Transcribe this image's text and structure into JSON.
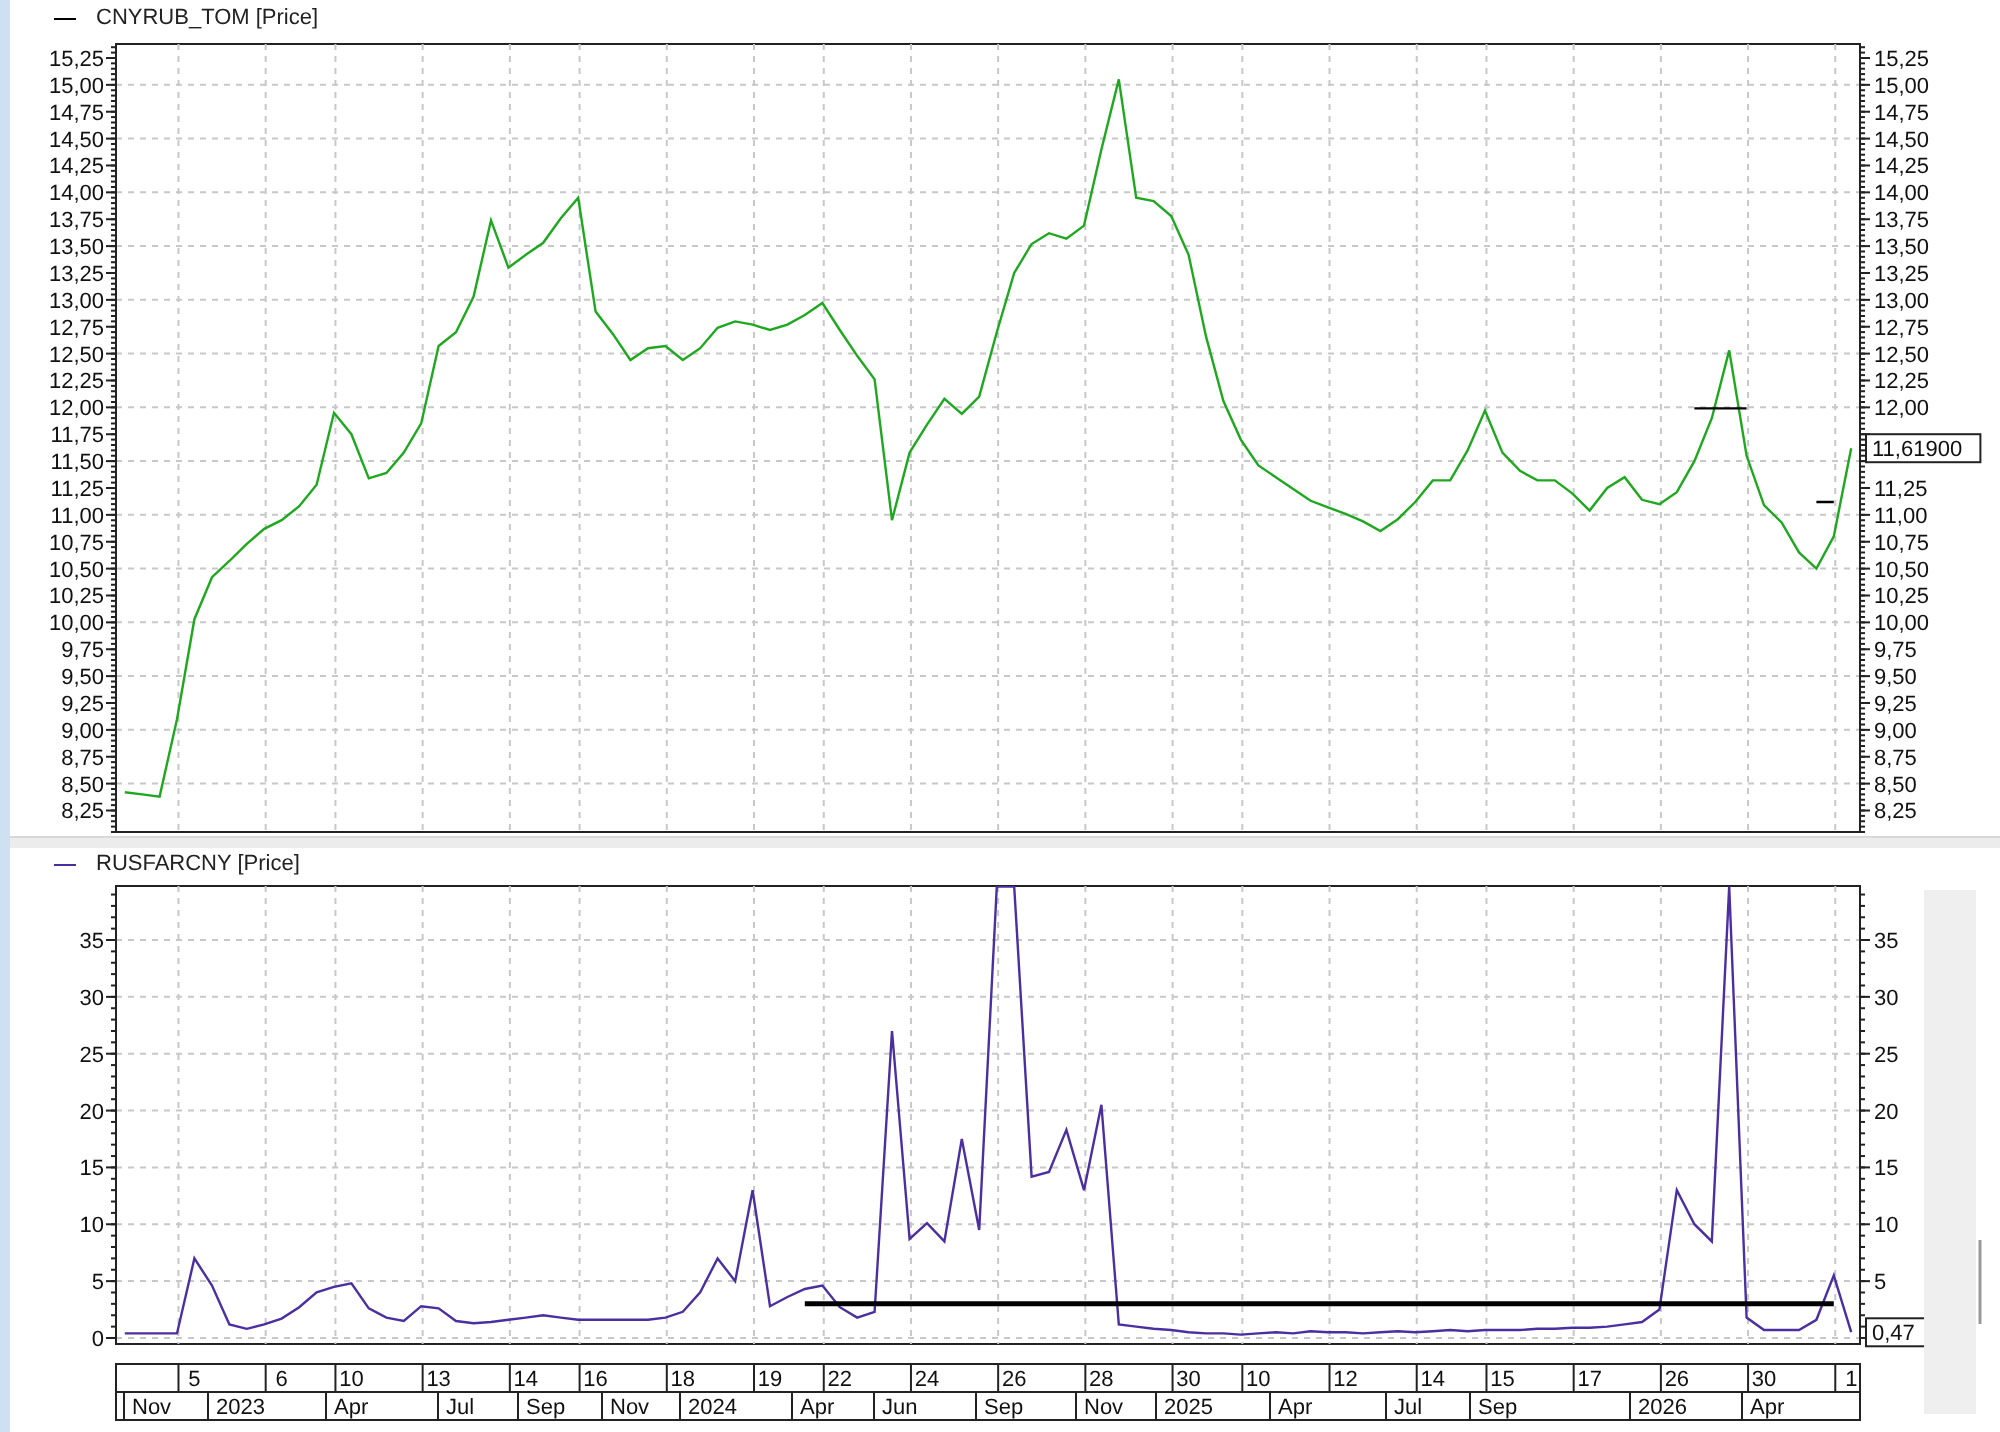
{
  "top_panel": {
    "chart_data": {
      "type": "line",
      "ylim": [
        8.05,
        15.38
      ],
      "categories": [
        null,
        null,
        null,
        null,
        null,
        null,
        null,
        null,
        null,
        null,
        null,
        null,
        null,
        null,
        null,
        null,
        null,
        null,
        null,
        null,
        null,
        null,
        null,
        null,
        null,
        null,
        null,
        null,
        null,
        null,
        null,
        null,
        null,
        null,
        null,
        null,
        null,
        null,
        null,
        null,
        null,
        null,
        null,
        null,
        null,
        null,
        null,
        null,
        null,
        null,
        null,
        null,
        null,
        null,
        null,
        null,
        null,
        null,
        null,
        null,
        null,
        null,
        null,
        null,
        null,
        null,
        null,
        null,
        null,
        null,
        null,
        null,
        null,
        null,
        null,
        null,
        null,
        null,
        null,
        null,
        null,
        null,
        null,
        null,
        null,
        null,
        null,
        null,
        null,
        null,
        null,
        null,
        null,
        null,
        null,
        null,
        null,
        null,
        null,
        null
      ],
      "yticks": [
        {
          "value": 15.25,
          "label": "15,25"
        },
        {
          "value": 15,
          "label": "15,00"
        },
        {
          "value": 14.75,
          "label": "14,75"
        },
        {
          "value": 14.5,
          "label": "14,50"
        },
        {
          "value": 14.25,
          "label": "14,25"
        },
        {
          "value": 14,
          "label": "14,00"
        },
        {
          "value": 13.75,
          "label": "13,75"
        },
        {
          "value": 13.5,
          "label": "13,50"
        },
        {
          "value": 13.25,
          "label": "13,25"
        },
        {
          "value": 13,
          "label": "13,00"
        },
        {
          "value": 12.75,
          "label": "12,75"
        },
        {
          "value": 12.5,
          "label": "12,50"
        },
        {
          "value": 12.25,
          "label": "12,25"
        },
        {
          "value": 12,
          "label": "12,00"
        },
        {
          "value": 11.75,
          "label": "11,75"
        },
        {
          "value": 11.5,
          "label": "11,50"
        },
        {
          "value": 11.25,
          "label": "11,25"
        },
        {
          "value": 11,
          "label": "11,00"
        },
        {
          "value": 10.75,
          "label": "10,75"
        },
        {
          "value": 10.5,
          "label": "10,50"
        },
        {
          "value": 10.25,
          "label": "10,25"
        },
        {
          "value": 10,
          "label": "10,00"
        },
        {
          "value": 9.75,
          "label": "9,75"
        },
        {
          "value": 9.5,
          "label": "9,50"
        },
        {
          "value": 9.25,
          "label": "9,25"
        },
        {
          "value": 9,
          "label": "9,00"
        },
        {
          "value": 8.75,
          "label": "8,75"
        },
        {
          "value": 8.5,
          "label": "8,50"
        },
        {
          "value": 8.25,
          "label": "8,25"
        }
      ],
      "series": [
        {
          "name": "CNYRUB_TOM [Price]",
          "color": "#1fa81f",
          "values": [
            8.42,
            8.4,
            8.38,
            9.1,
            10.03,
            10.42,
            10.57,
            10.73,
            10.87,
            10.95,
            11.08,
            11.28,
            11.95,
            11.75,
            11.34,
            11.39,
            11.58,
            11.85,
            12.57,
            12.7,
            13.03,
            13.74,
            13.3,
            13.42,
            13.53,
            13.76,
            13.95,
            12.89,
            12.68,
            12.44,
            12.55,
            12.57,
            12.44,
            12.55,
            12.74,
            12.8,
            12.77,
            12.72,
            12.77,
            12.86,
            12.97,
            12.72,
            12.48,
            12.26,
            10.95,
            11.58,
            11.84,
            12.08,
            11.94,
            12.1,
            12.7,
            13.25,
            13.52,
            13.62,
            13.57,
            13.69,
            14.4,
            15.05,
            13.95,
            13.92,
            13.78,
            13.42,
            12.66,
            12.06,
            11.7,
            11.46,
            11.35,
            11.24,
            11.13,
            11.07,
            11.01,
            10.94,
            10.85,
            10.96,
            11.12,
            11.32,
            11.32,
            11.6,
            11.97,
            11.58,
            11.41,
            11.32,
            11.32,
            11.2,
            11.04,
            11.25,
            11.35,
            11.14,
            11.1,
            11.21,
            11.5,
            11.9,
            12.53,
            11.55,
            11.09,
            10.93,
            10.65,
            10.5,
            10.8,
            11.62
          ]
        },
        {
          "color": "#000000",
          "values": [
            null,
            null,
            null,
            null,
            null,
            null,
            null,
            null,
            null,
            null,
            null,
            null,
            null,
            null,
            null,
            null,
            null,
            null,
            null,
            null,
            null,
            null,
            null,
            null,
            null,
            null,
            null,
            null,
            null,
            null,
            null,
            null,
            null,
            null,
            null,
            null,
            null,
            null,
            null,
            null,
            null,
            null,
            null,
            null,
            null,
            null,
            null,
            null,
            null,
            null,
            null,
            null,
            null,
            null,
            null,
            null,
            null,
            null,
            null,
            null,
            null,
            null,
            null,
            null,
            null,
            null,
            null,
            null,
            null,
            null,
            null,
            null,
            null,
            null,
            null,
            null,
            null,
            null,
            null,
            null,
            null,
            null,
            null,
            null,
            null,
            null,
            null,
            null,
            null,
            null,
            11.99,
            11.99,
            11.99,
            11.99,
            null,
            null,
            null,
            11.12,
            11.12,
            null
          ]
        }
      ],
      "grid": true,
      "annotations": [
        "11,61900"
      ]
    }
  },
  "bottom_panel": {
    "month_labels": [
      "Nov",
      "2023",
      "Apr",
      "Jul",
      "Sep",
      "Nov",
      "2024",
      "Apr",
      "Jun",
      "Sep",
      "Nov",
      "2025",
      "Apr",
      "Jul",
      "Sep",
      "2026",
      "Apr"
    ],
    "chart_data": {
      "type": "line",
      "ylim": [
        -0.53,
        39.75
      ],
      "categories": [
        null,
        null,
        null,
        null,
        "5",
        null,
        null,
        null,
        null,
        "6",
        null,
        null,
        null,
        "10",
        null,
        null,
        null,
        null,
        "13",
        null,
        null,
        null,
        null,
        "14",
        null,
        null,
        null,
        "16",
        null,
        null,
        null,
        null,
        "18",
        null,
        null,
        null,
        null,
        "19",
        null,
        null,
        null,
        "22",
        null,
        null,
        null,
        null,
        "24",
        null,
        null,
        null,
        null,
        "26",
        null,
        null,
        null,
        null,
        "28",
        null,
        null,
        null,
        null,
        "30",
        null,
        null,
        null,
        "10",
        null,
        null,
        null,
        null,
        "12",
        null,
        null,
        null,
        null,
        "14",
        null,
        null,
        null,
        "15",
        null,
        null,
        null,
        null,
        "17",
        null,
        null,
        null,
        null,
        "26",
        null,
        null,
        null,
        null,
        "30",
        null,
        null,
        null,
        null,
        "1"
      ],
      "yticks": [
        {
          "value": 35,
          "label": "35"
        },
        {
          "value": 30,
          "label": "30"
        },
        {
          "value": 25,
          "label": "25"
        },
        {
          "value": 20,
          "label": "20"
        },
        {
          "value": 15,
          "label": "15"
        },
        {
          "value": 10,
          "label": "10"
        },
        {
          "value": 5,
          "label": "5"
        },
        {
          "value": 0,
          "label": "0"
        }
      ],
      "series": [
        {
          "name": "RUSFARCNY [Price]",
          "color": "#4b2fa0",
          "values": [
            0.4,
            0.4,
            0.4,
            0.4,
            7,
            4.6,
            1.2,
            0.8,
            1.2,
            1.7,
            2.7,
            4,
            4.5,
            4.8,
            2.6,
            1.8,
            1.5,
            2.8,
            2.6,
            1.5,
            1.3,
            1.4,
            1.6,
            1.8,
            2,
            1.8,
            1.6,
            1.6,
            1.6,
            1.6,
            1.6,
            1.8,
            2.3,
            4,
            7,
            5,
            13,
            2.8,
            3.6,
            4.3,
            4.6,
            2.7,
            1.8,
            2.3,
            27,
            8.7,
            10.1,
            8.5,
            17.5,
            9.5,
            39.7,
            39.7,
            14.2,
            14.6,
            18.3,
            13,
            20.5,
            1.2,
            1,
            0.8,
            0.7,
            0.5,
            0.4,
            0.4,
            0.3,
            0.4,
            0.5,
            0.4,
            0.6,
            0.5,
            0.5,
            0.4,
            0.5,
            0.6,
            0.5,
            0.6,
            0.7,
            0.6,
            0.7,
            0.7,
            0.7,
            0.8,
            0.8,
            0.9,
            0.9,
            1,
            1.2,
            1.4,
            2.5,
            13,
            10,
            8.5,
            39.7,
            1.8,
            0.7,
            0.7,
            0.7,
            1.6,
            5.5,
            0.5
          ]
        },
        {
          "color": "#000000",
          "values": [
            null,
            null,
            null,
            null,
            null,
            null,
            null,
            null,
            null,
            null,
            null,
            null,
            null,
            null,
            null,
            null,
            null,
            null,
            null,
            null,
            null,
            null,
            null,
            null,
            null,
            null,
            null,
            null,
            null,
            null,
            null,
            null,
            null,
            null,
            null,
            null,
            null,
            null,
            null,
            3.0,
            3.0,
            3.0,
            3.0,
            3.0,
            3.0,
            3.0,
            3.0,
            3.0,
            3.0,
            3.0,
            3.0,
            3.0,
            3.0,
            3.0,
            3.0,
            3.0,
            3.0,
            3.0,
            3.0,
            3.0,
            3.0,
            3.0,
            3.0,
            3.0,
            3.0,
            3.0,
            3.0,
            3.0,
            3.0,
            3.0,
            3.0,
            3.0,
            3.0,
            3.0,
            3.0,
            3.0,
            3.0,
            3.0,
            3.0,
            3.0,
            3.0,
            3.0,
            3.0,
            3.0,
            3.0,
            3.0,
            3.0,
            3.0,
            3.0,
            3.0,
            3.0,
            3.0,
            3.0,
            3.0,
            3.0,
            3.0,
            3.0,
            3.0,
            3.0,
            null
          ]
        }
      ],
      "grid": true,
      "annotations": [
        "0,47"
      ]
    }
  }
}
